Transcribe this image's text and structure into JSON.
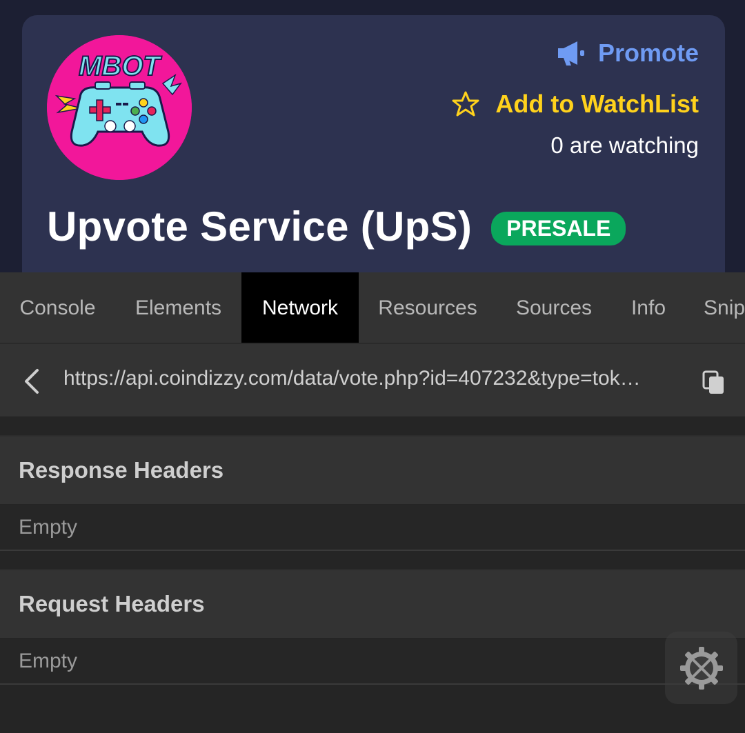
{
  "token": {
    "logo_text": "MBOT",
    "name": "Upvote Service (UpS)",
    "badge": "PRESALE"
  },
  "actions": {
    "promote_label": "Promote",
    "watchlist_label": "Add to WatchList",
    "watching_text": "0 are watching"
  },
  "devtools": {
    "tabs": [
      {
        "label": "Console"
      },
      {
        "label": "Elements"
      },
      {
        "label": "Network",
        "active": true
      },
      {
        "label": "Resources"
      },
      {
        "label": "Sources"
      },
      {
        "label": "Info"
      },
      {
        "label": "Snip"
      }
    ],
    "request_url": "https://api.coindizzy.com/data/vote.php?id=407232&type=tok…",
    "sections": [
      {
        "title": "Response Headers",
        "body": "Empty"
      },
      {
        "title": "Request Headers",
        "body": "Empty"
      }
    ]
  },
  "icons": {
    "promote": "megaphone-icon",
    "watchlist": "star-outline-icon",
    "back": "chevron-left-icon",
    "copy": "copy-icon",
    "settings": "settings-tools-icon"
  },
  "colors": {
    "page_bg": "#1c1f33",
    "card_bg": "#2d3250",
    "promote": "#6f9bf3",
    "watchlist": "#ffd21c",
    "badge": "#0aa75c",
    "logo_bg": "#f2179a",
    "devtools_bg": "#333333",
    "active_tab": "#000000"
  }
}
